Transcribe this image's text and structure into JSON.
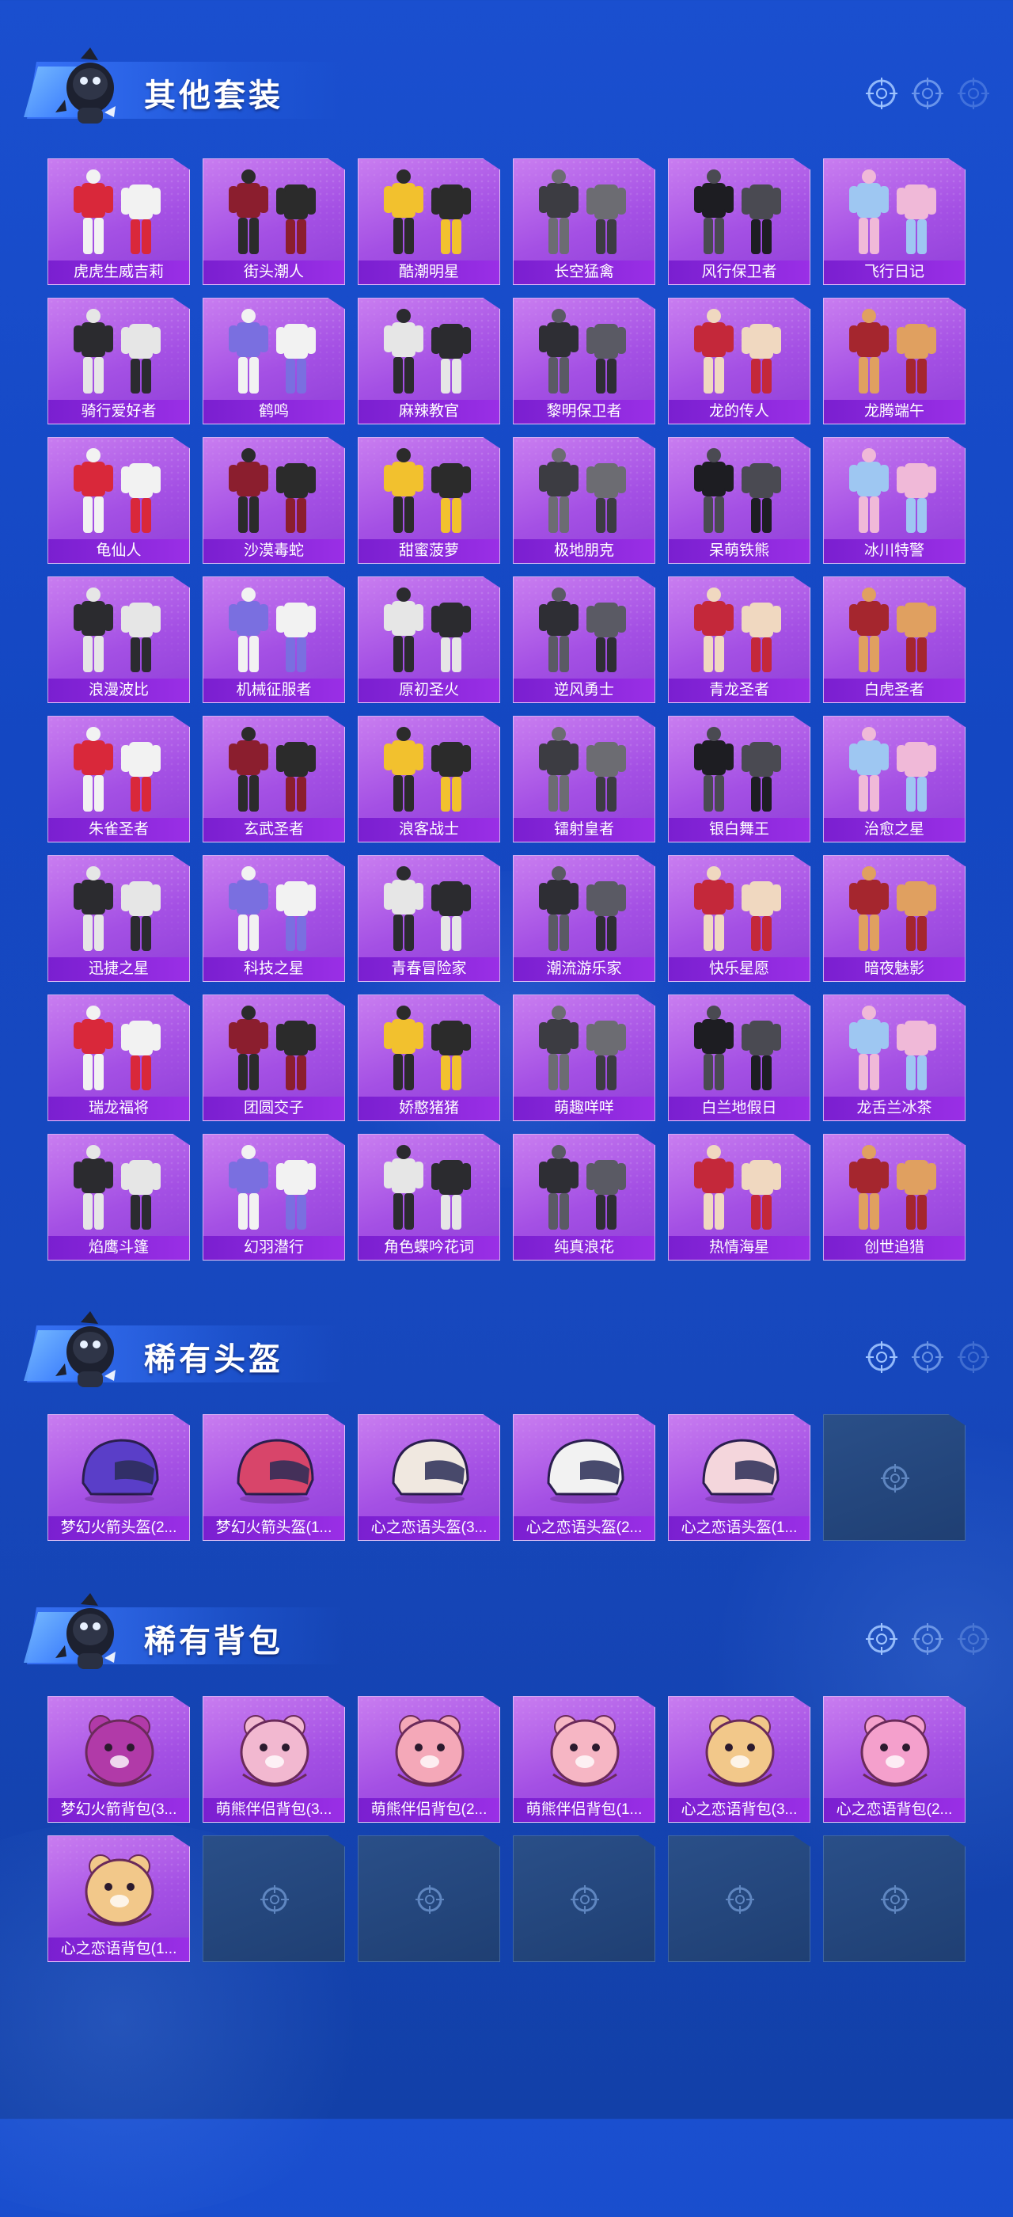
{
  "sections": [
    {
      "title": "其他套装",
      "items": [
        {
          "name": "虎虎生威吉莉",
          "icon": "red-outfit-icon"
        },
        {
          "name": "街头潮人",
          "icon": "red-jacket-outfit-icon"
        },
        {
          "name": "酷潮明星",
          "icon": "yellow-jacket-outfit-icon"
        },
        {
          "name": "长空猛禽",
          "icon": "camo-outfit-icon"
        },
        {
          "name": "风行保卫者",
          "icon": "black-coat-outfit-icon"
        },
        {
          "name": "飞行日记",
          "icon": "pastel-outfit-icon"
        },
        {
          "name": "骑行爱好者",
          "icon": "biker-jacket-icon"
        },
        {
          "name": "鹤鸣",
          "icon": "purple-jacket-icon"
        },
        {
          "name": "麻辣教官",
          "icon": "white-uniform-outfit-icon"
        },
        {
          "name": "黎明保卫者",
          "icon": "black-leather-outfit-icon"
        },
        {
          "name": "龙的传人",
          "icon": "red-dragon-outfit-icon"
        },
        {
          "name": "龙腾端午",
          "icon": "red-coat-outfit-icon"
        },
        {
          "name": "龟仙人",
          "icon": "yellow-shirt-icon"
        },
        {
          "name": "沙漠毒蛇",
          "icon": "brown-outfit-icon"
        },
        {
          "name": "甜蜜菠萝",
          "icon": "yellow-outfit-icon"
        },
        {
          "name": "极地朋克",
          "icon": "gold-black-outfit-icon"
        },
        {
          "name": "呆萌铁熊",
          "icon": "bear-outfit-icon"
        },
        {
          "name": "冰川特警",
          "icon": "white-suit-icon"
        },
        {
          "name": "浪漫波比",
          "icon": "brown-black-outfit-icon"
        },
        {
          "name": "机械征服者",
          "icon": "armor-coat-outfit-icon"
        },
        {
          "name": "原初圣火",
          "icon": "dark-armor-icon"
        },
        {
          "name": "逆风勇士",
          "icon": "grey-armor-icon"
        },
        {
          "name": "青龙圣者",
          "icon": "teal-outfit-icon"
        },
        {
          "name": "白虎圣者",
          "icon": "white-armor-outfit-icon"
        },
        {
          "name": "朱雀圣者",
          "icon": "red-armor-outfit-icon"
        },
        {
          "name": "玄武圣者",
          "icon": "green-outfit-icon"
        },
        {
          "name": "浪客战士",
          "icon": "black-robe-icon"
        },
        {
          "name": "镭射皇者",
          "icon": "violet-outfit-icon"
        },
        {
          "name": "银白舞王",
          "icon": "silver-outfit-icon"
        },
        {
          "name": "治愈之星",
          "icon": "white-dress-outfit-icon"
        },
        {
          "name": "迅捷之星",
          "icon": "grey-dark-outfit-icon"
        },
        {
          "name": "科技之星",
          "icon": "tech-outfit-icon"
        },
        {
          "name": "青春冒险家",
          "icon": "red-white-outfit-icon"
        },
        {
          "name": "潮流游乐家",
          "icon": "blue-outfit-icon"
        },
        {
          "name": "快乐星愿",
          "icon": "purple-armor-outfit-icon"
        },
        {
          "name": "暗夜魅影",
          "icon": "teal-dark-outfit-icon"
        },
        {
          "name": "瑞龙福将",
          "icon": "red-gold-outfit-icon"
        },
        {
          "name": "团圆交子",
          "icon": "orange-outfit-icon"
        },
        {
          "name": "娇憨猪猪",
          "icon": "pink-outfit-icon"
        },
        {
          "name": "萌趣咩咩",
          "icon": "light-blue-outfit-icon"
        },
        {
          "name": "白兰地假日",
          "icon": "checkered-outfit-icon"
        },
        {
          "name": "龙舌兰冰茶",
          "icon": "lime-outfit-icon"
        },
        {
          "name": "焰鹰斗篷",
          "icon": "red-black-outfit-icon"
        },
        {
          "name": "幻羽潜行",
          "icon": "green-black-outfit-icon"
        },
        {
          "name": "角色蝶吟花词",
          "icon": "pink-character-icon"
        },
        {
          "name": "纯真浪花",
          "icon": "colorful-outfit-icon"
        },
        {
          "name": "热情海星",
          "icon": "aqua-outfit-icon"
        },
        {
          "name": "创世追猎",
          "icon": "magenta-outfit-icon"
        }
      ]
    },
    {
      "title": "稀有头盔",
      "items": [
        {
          "name": "梦幻火箭头盔(2...",
          "icon": "helmet-icon"
        },
        {
          "name": "梦幻火箭头盔(1...",
          "icon": "helmet-icon"
        },
        {
          "name": "心之恋语头盔(3...",
          "icon": "shell-helmet-icon"
        },
        {
          "name": "心之恋语头盔(2...",
          "icon": "helmet-icon"
        },
        {
          "name": "心之恋语头盔(1...",
          "icon": "helmet-icon"
        },
        {
          "name": "",
          "icon": "empty-slot-icon",
          "empty": true
        }
      ]
    },
    {
      "title": "稀有背包",
      "items": [
        {
          "name": "梦幻火箭背包(3...",
          "icon": "rocket-backpack-icon"
        },
        {
          "name": "萌熊伴侣背包(3...",
          "icon": "bear-backpack-icon"
        },
        {
          "name": "萌熊伴侣背包(2...",
          "icon": "bear-backpack-icon"
        },
        {
          "name": "萌熊伴侣背包(1...",
          "icon": "bear-backpack-icon"
        },
        {
          "name": "心之恋语背包(3...",
          "icon": "star-backpack-icon"
        },
        {
          "name": "心之恋语背包(2...",
          "icon": "pink-backpack-icon"
        },
        {
          "name": "心之恋语背包(1...",
          "icon": "star-backpack-icon"
        },
        {
          "name": "",
          "icon": "empty-slot-icon",
          "empty": true
        },
        {
          "name": "",
          "icon": "empty-slot-icon",
          "empty": true
        },
        {
          "name": "",
          "icon": "empty-slot-icon",
          "empty": true
        },
        {
          "name": "",
          "icon": "empty-slot-icon",
          "empty": true
        },
        {
          "name": "",
          "icon": "empty-slot-icon",
          "empty": true
        }
      ]
    }
  ],
  "colors": {
    "background": "#1a4fcf",
    "card_purple": "#a450e4",
    "label_bar": "#7a1fd0",
    "empty_slot": "#24467d"
  },
  "header_icons": [
    "crosshair-icon",
    "crosshair-icon",
    "crosshair-icon"
  ]
}
